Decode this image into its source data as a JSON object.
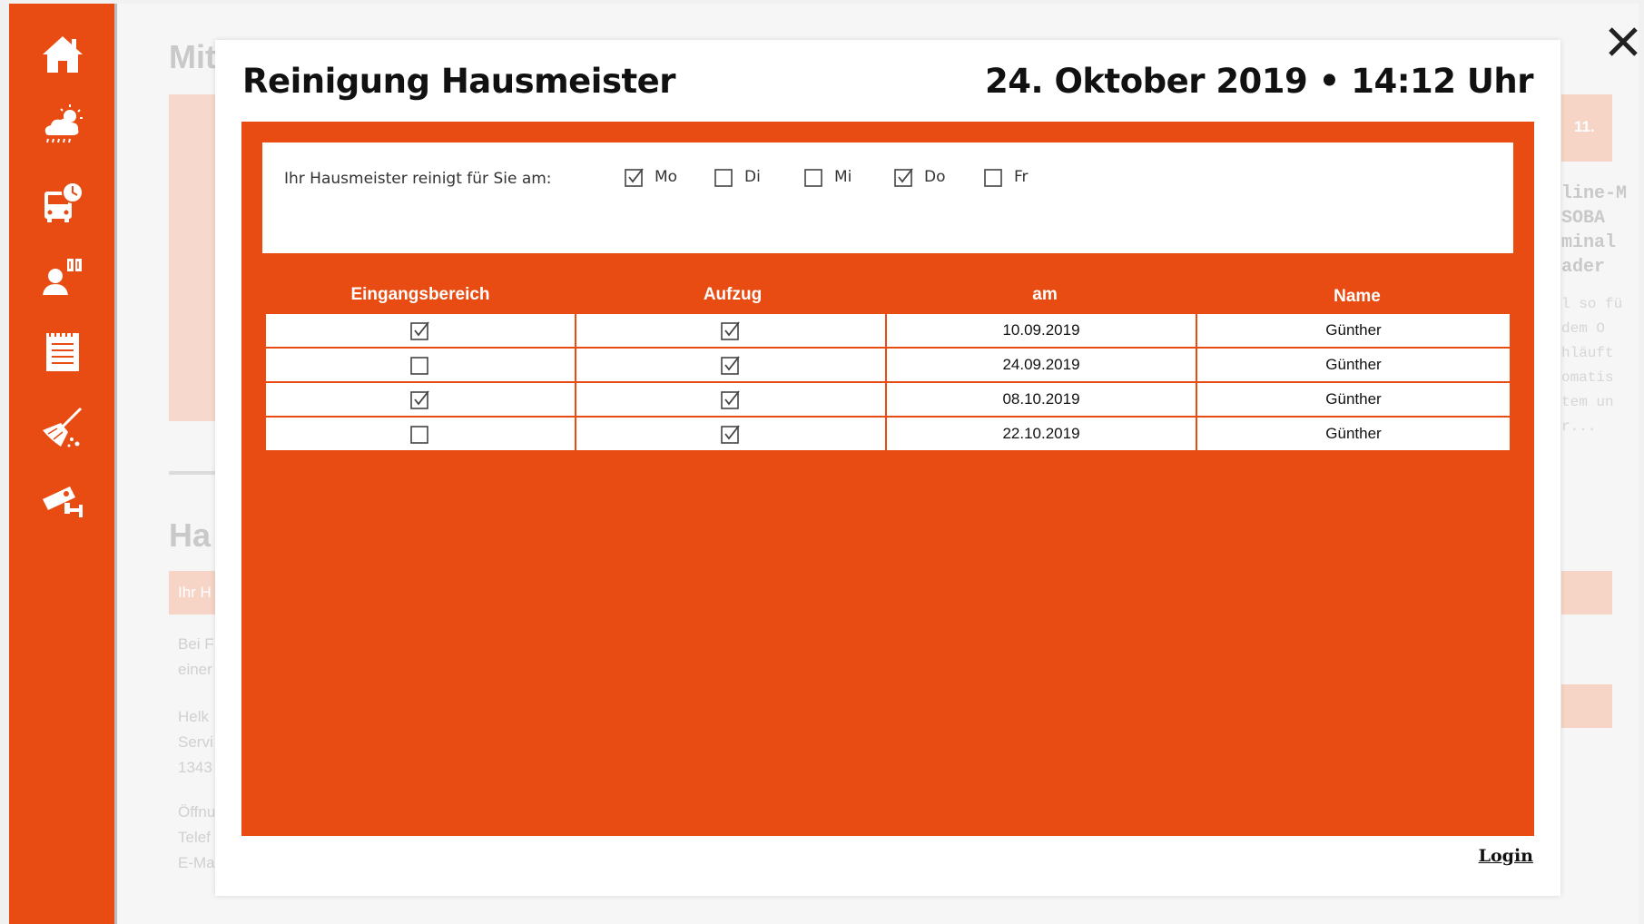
{
  "sidebar": {
    "items": [
      {
        "icon": "home-icon"
      },
      {
        "icon": "weather-icon"
      },
      {
        "icon": "bus-schedule-icon"
      },
      {
        "icon": "contact-person-icon"
      },
      {
        "icon": "notepad-icon"
      },
      {
        "icon": "cleaning-broom-icon"
      },
      {
        "icon": "security-camera-icon"
      }
    ],
    "accent": "#e84c12"
  },
  "background": {
    "title_top": "Mit",
    "title_mid": "Ha",
    "block_label": "Ihr H",
    "text_lines_1": [
      "Bei F",
      "einer"
    ],
    "text_lines_2": [
      "Helk",
      "Servi",
      "1343"
    ],
    "text_lines_3": [
      "Öffnu",
      "Telef",
      "E-Ma"
    ],
    "right_title_lines": [
      "line-M",
      "SOBA",
      "minal",
      "ader"
    ],
    "right_small_lines": [
      "l so fü",
      "dem O",
      "hläuft",
      "omatis",
      "tem un",
      "r..."
    ],
    "right_badge": "11."
  },
  "modal": {
    "title": "Reinigung Hausmeister",
    "datetime": "24. Oktober 2019 • 14:12 Uhr",
    "days_label": "Ihr Hausmeister reinigt für Sie am:",
    "days": [
      {
        "label": "Mo",
        "checked": true
      },
      {
        "label": "Di",
        "checked": false
      },
      {
        "label": "Mi",
        "checked": false
      },
      {
        "label": "Do",
        "checked": true
      },
      {
        "label": "Fr",
        "checked": false
      }
    ],
    "table": {
      "headers": [
        "Eingangsbereich",
        "Aufzug",
        "am",
        "Name"
      ],
      "rows": [
        {
          "eingang": true,
          "aufzug": true,
          "am": "10.09.2019",
          "name": "Günther"
        },
        {
          "eingang": false,
          "aufzug": true,
          "am": "24.09.2019",
          "name": "Günther"
        },
        {
          "eingang": true,
          "aufzug": true,
          "am": "08.10.2019",
          "name": "Günther"
        },
        {
          "eingang": false,
          "aufzug": true,
          "am": "22.10.2019",
          "name": "Günther"
        }
      ]
    },
    "login_label": "Login"
  }
}
